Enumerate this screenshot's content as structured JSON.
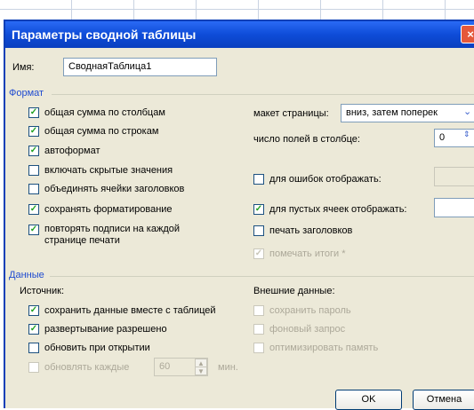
{
  "window": {
    "title": "Параметры сводной таблицы",
    "close": "×"
  },
  "name_field": {
    "label": "Имя:",
    "value": "СводнаяТаблица1"
  },
  "format_section": {
    "title": "Формат",
    "grand_total_cols": "общая сумма по столбцам",
    "grand_total_rows": "общая сумма по строкам",
    "autoformat": "автоформат",
    "include_hidden": "включать скрытые значения",
    "merge_labels": "объединять ячейки заголовков",
    "preserve_formatting": "сохранять форматирование",
    "repeat_labels_line1": "повторять подписи на каждой",
    "repeat_labels_line2": "странице печати",
    "page_layout_label": "макет страницы:",
    "page_layout_value": "вниз, затем поперек",
    "fields_per_col_label": "число полей в столбце:",
    "fields_per_col_value": "0",
    "error_values_label": "для ошибок отображать:",
    "empty_cells_label": "для пустых ячеек отображать:",
    "print_titles": "печать заголовков",
    "mark_totals": "помечать итоги *"
  },
  "data_section": {
    "title": "Данные",
    "source_label": "Источник:",
    "save_data": "сохранить данные вместе с таблицей",
    "enable_drilldown": "развертывание разрешено",
    "refresh_on_open": "обновить при открытии",
    "refresh_every": "обновлять каждые",
    "refresh_minutes": "60",
    "minutes_unit": "мин.",
    "external_label": "Внешние данные:",
    "save_password": "сохранить пароль",
    "background_query": "фоновый запрос",
    "optimize_memory": "оптимизировать память"
  },
  "buttons": {
    "ok": "OK",
    "cancel": "Отмена"
  },
  "icons": {
    "check": "✓",
    "dropdown": "chevron-down-icon",
    "spin_up": "▲",
    "spin_down": "▼"
  }
}
